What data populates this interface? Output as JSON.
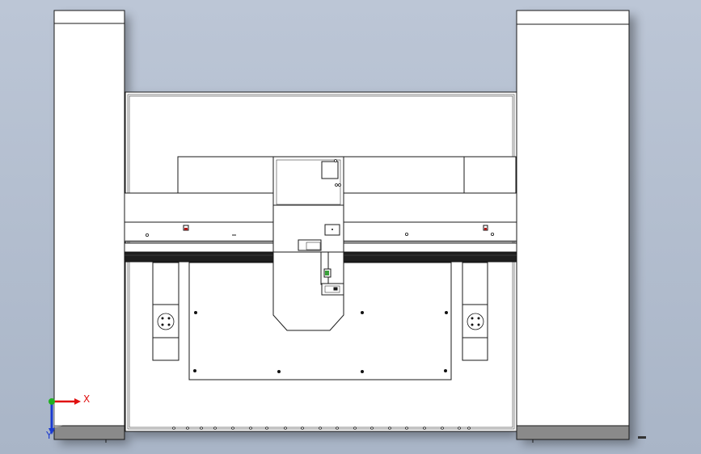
{
  "viewport": {
    "background_top": "#bcc6d6",
    "background_bottom": "#a9b5c7"
  },
  "triad": {
    "x_label": "X",
    "y_label": "Y",
    "x_color": "#e01010",
    "y_color": "#20b020",
    "z_color": "#1a3ad0"
  }
}
